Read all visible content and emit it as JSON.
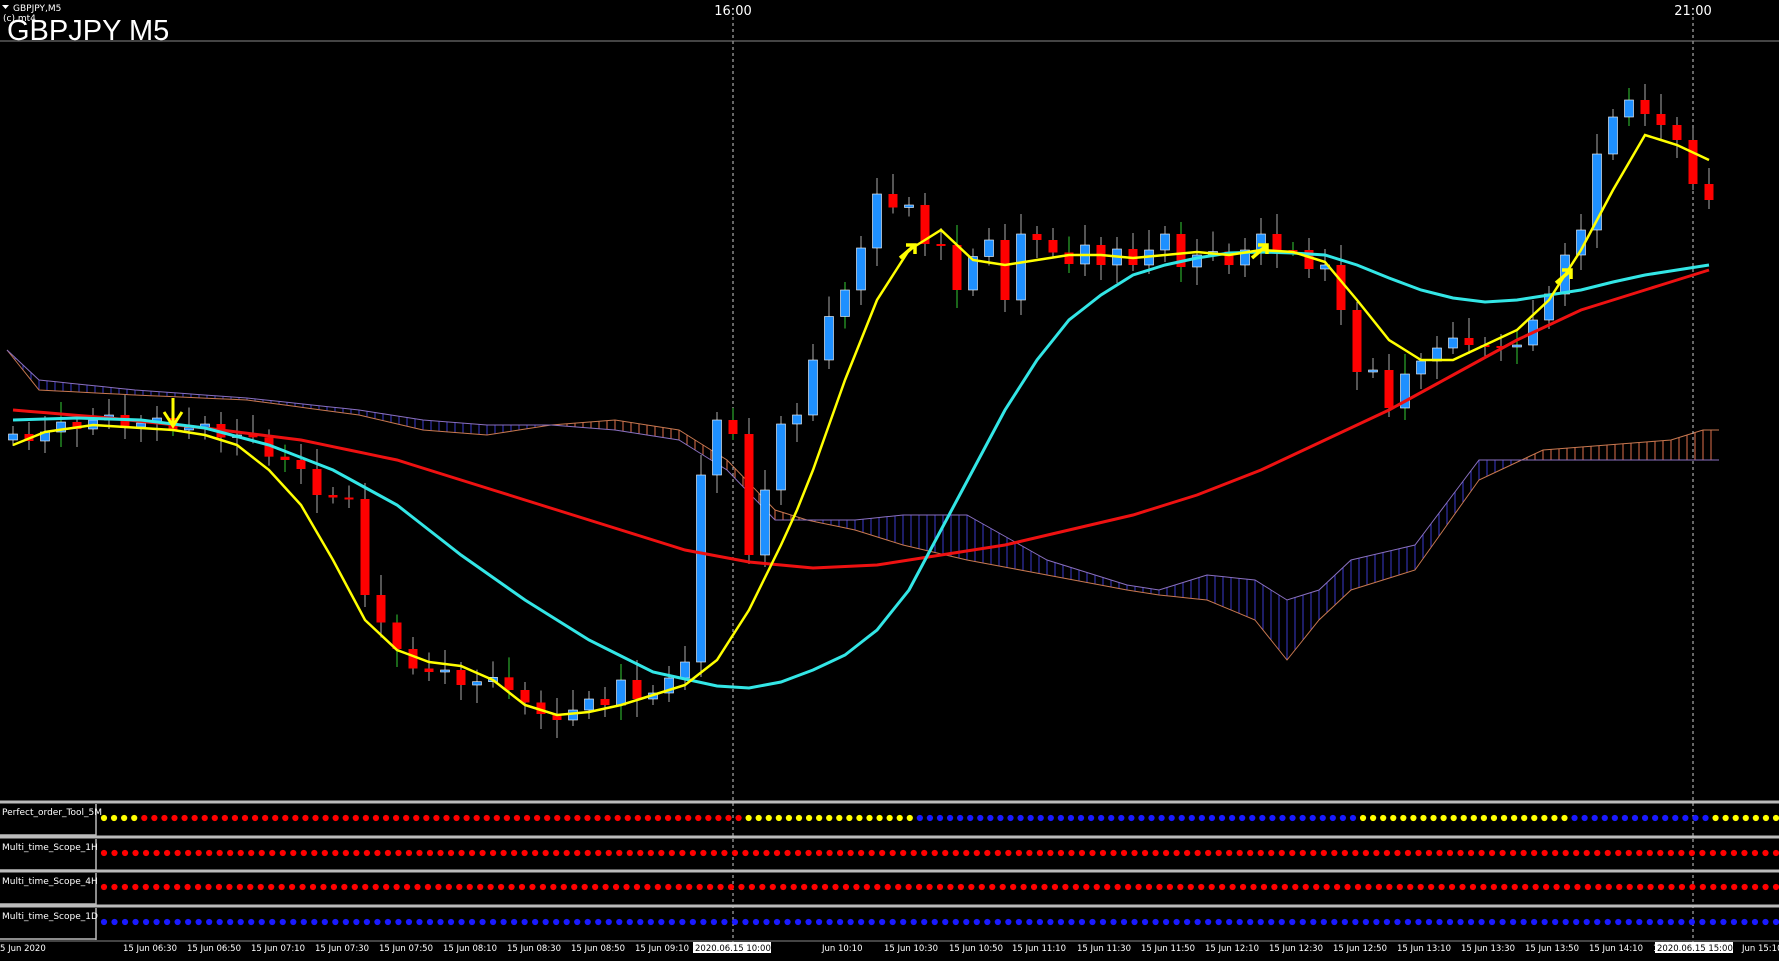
{
  "window": {
    "symbol_caption": "GBPJPY,M5",
    "copyright_caption": "(c) mt4",
    "chart_title": "GBPJPY M5"
  },
  "colors": {
    "background": "#000000",
    "bull_candle": "#1e90ff",
    "bear_candle": "#ff0000",
    "ma_fast": "#ffff00",
    "ma_mid": "#33e6e6",
    "ma_slow": "#ee1111",
    "cloud_bear": "#e0704d",
    "cloud_bull": "#3a3acc",
    "arrow": "#ffff00",
    "dot_red": "#ff0000",
    "dot_yellow": "#ffff00",
    "dot_blue": "#1a1aff"
  },
  "time_axis": {
    "top_labels": [
      "16:00",
      "21:00"
    ],
    "bottom_labels": [
      "5 Jun 2020",
      "15 Jun 06:30",
      "15 Jun 06:50",
      "15 Jun 07:10",
      "15 Jun 07:30",
      "15 Jun 07:50",
      "15 Jun 08:10",
      "15 Jun 08:30",
      "15 Jun 08:50",
      "15 Jun 09:10",
      "15 Jun 09:30",
      "2020.06.15 10:00",
      "Jun 10:10",
      "15 Jun 10:30",
      "15 Jun 10:50",
      "15 Jun 11:10",
      "15 Jun 11:30",
      "15 Jun 11:50",
      "15 Jun 12:10",
      "15 Jun 12:30",
      "15 Jun 12:50",
      "15 Jun 13:10",
      "15 Jun 13:30",
      "15 Jun 13:50",
      "15 Jun 14:10",
      "15 Jun 14:30",
      "2020.06.15 15:00",
      "Jun 15:10"
    ],
    "highlighted_labels": [
      "2020.06.15 10:00",
      "2020.06.15 15:00"
    ]
  },
  "indicators": [
    {
      "name": "Perfect_order_Tool_5M",
      "dots": "YYYYRRRRRRRRRRRRRRRRRRRRRRRRRRRRRRRRRRRRRRRRRRRRRRRRRRRRRRRRRRRRYYYYYYYYYYYYYYYYYBBBBBBBBBBBBBBBBBBBBBBBBBBBBBBBBBBBBBBBBBBBBYYYYYYYYYYYYYYYYYYYYYBBBBBBBBBBBBBBYYYYYYY"
    },
    {
      "name": "Multi_time_Scope_1H",
      "dots": "RRRRRRRRRRRRRRRRRRRRRRRRRRRRRRRRRRRRRRRRRRRRRRRRRRRRRRRRRRRRRRRRRRRRRRRRRRRRRRRRRRRRRRRRRRRRRRRRRRRRRRRRRRRRRRRRRRRRRRRRRRRRRRRRRRRRRRRRRRRRRRRRRRRRRRRRRRRRRRRR"
    },
    {
      "name": "Multi_time_Scope_4H",
      "dots": "RRRRRRRRRRRRRRRRRRRRRRRRRRRRRRRRRRRRRRRRRRRRRRRRRRRRRRRRRRRRRRRRRRRRRRRRRRRRRRRRRRRRRRRRRRRRRRRRRRRRRRRRRRRRRRRRRRRRRRRRRRRRRRRRRRRRRRRRRRRRRRRRRRRRRRRRRRRRRRRRR"
    },
    {
      "name": "Multi_time_Scope_1D",
      "dots": "BBBBBBBBBBBBBBBBBBBBBBBBBBBBBBBBBBBBBBBBBBBBBBBBBBBBBBBBBBBBBBBBBBBBBBBBBBBBBBBBBBBBBBBBBBBBBBBBBBBBBBBBBBBBBBBBBBBBBBBBBBBBBBBBBBBBBBBBBBBBBBBBBBBBBBBBBBBBBBBB"
    }
  ],
  "signals": [
    {
      "type": "sell-arrow",
      "bar": 10
    },
    {
      "type": "buy-arrow",
      "bar": 56
    },
    {
      "type": "buy-arrow",
      "bar": 78
    },
    {
      "type": "buy-arrow",
      "bar": 97
    }
  ]
}
